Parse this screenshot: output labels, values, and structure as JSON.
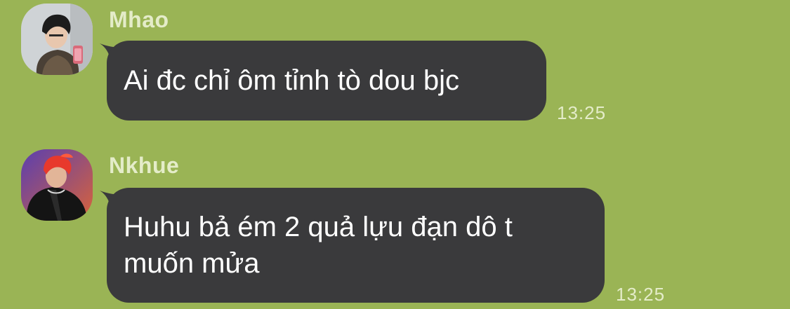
{
  "messages": [
    {
      "sender": "Mhao",
      "avatar_icon": "user-avatar-photo",
      "text": "Ai đc chỉ ôm tỉnh tò dou bjc",
      "time": "13:25"
    },
    {
      "sender": "Nkhue",
      "avatar_icon": "user-avatar-photo",
      "text_lines": [
        "Huhu bả ém 2 quả lựu đạn dô t",
        "muốn mửa"
      ],
      "time": "13:25"
    }
  ],
  "colors": {
    "chat_background": "#9ab455",
    "bubble": "#3a3a3c",
    "meta_text": "#e4ecc9"
  }
}
